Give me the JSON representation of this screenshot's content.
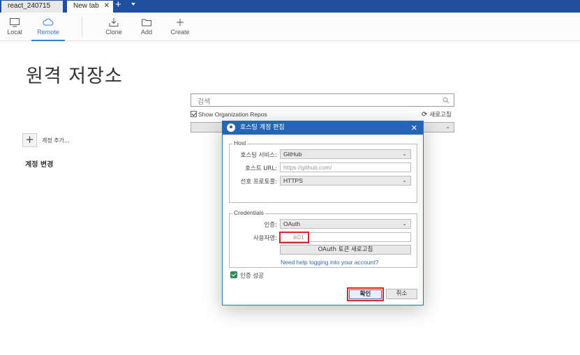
{
  "tabs": [
    {
      "label": "react_240715"
    },
    {
      "label": "New tab",
      "close": "✕"
    }
  ],
  "titlebar": {
    "new_tab": "+"
  },
  "toolbar": {
    "local": "Local",
    "remote": "Remote",
    "clone": "Clone",
    "add": "Add",
    "create": "Create"
  },
  "main": {
    "title": "원격 저장소",
    "add_account": "계정 추가...",
    "switch_account": "계정 변경",
    "search_placeholder": "검색",
    "show_org_repos": "Show Organization Repos",
    "refresh": "새로고침"
  },
  "dialog": {
    "title": "호스팅 계정 편집",
    "host_group": "Host",
    "hosting_service_label": "호스팅 서비스:",
    "hosting_service_value": "GitHub",
    "host_url_label": "호스트 URL:",
    "host_url_placeholder": "https://github.com/",
    "protocol_label": "선호 프로토콜:",
    "protocol_value": "HTTPS",
    "credentials_group": "Credentials",
    "auth_label": "인증:",
    "auth_value": "OAuth",
    "username_label": "사용자명:",
    "username_value": "ik01",
    "oauth_refresh": "OAuth 토큰 새로고침",
    "help_link": "Need help logging into your account?",
    "auth_success": "인증 성공",
    "ok": "확인",
    "cancel": "취소"
  },
  "colors": {
    "titlebar": "#1f4f9e",
    "accent": "#3a7bd5",
    "highlight": "#d9252b"
  }
}
